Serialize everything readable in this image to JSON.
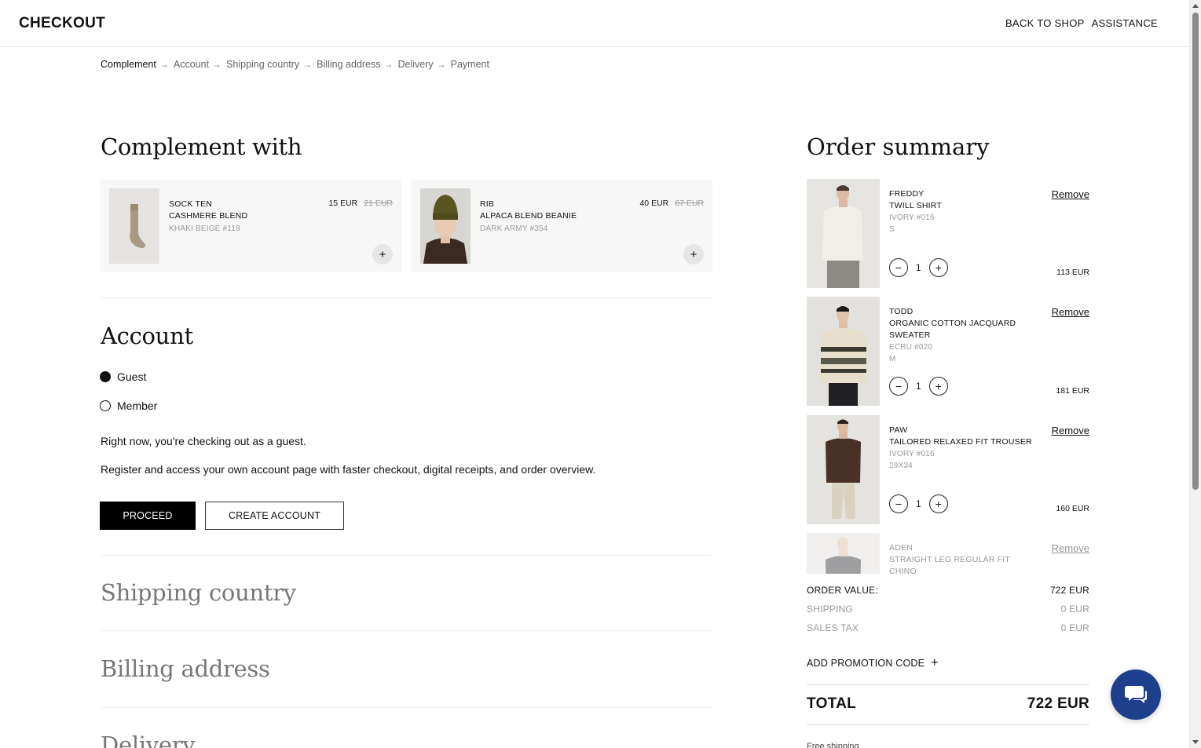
{
  "header": {
    "logo": "CHECKOUT",
    "back_to_shop": "BACK TO SHOP",
    "assistance": "ASSISTANCE"
  },
  "breadcrumb": [
    "Complement",
    "Account",
    "Shipping country",
    "Billing address",
    "Delivery",
    "Payment"
  ],
  "complement": {
    "title": "Complement with",
    "items": [
      {
        "name_line1": "SOCK TEN",
        "name_line2": "CASHMERE BLEND",
        "color": "KHAKI BEIGE #119",
        "price": "15 EUR",
        "old_price": "21 EUR"
      },
      {
        "name_line1": "RIB",
        "name_line2": "ALPACA BLEND BEANIE",
        "color": "DARK ARMY #354",
        "price": "40 EUR",
        "old_price": "67 EUR"
      }
    ]
  },
  "account": {
    "title": "Account",
    "options": [
      "Guest",
      "Member"
    ],
    "selected": "Guest",
    "line1": "Right now, you're checking out as a guest.",
    "line2": "Register and access your own account page with faster checkout, digital receipts, and order overview.",
    "proceed": "PROCEED",
    "create_account": "CREATE ACCOUNT"
  },
  "sections": {
    "shipping": "Shipping country",
    "billing": "Billing address",
    "delivery": "Delivery"
  },
  "summary": {
    "title": "Order summary",
    "remove_label": "Remove",
    "items": [
      {
        "name_line1": "FREDDY",
        "name_line2": "TWILL SHIRT",
        "color": "IVORY #016",
        "size": "S",
        "qty": "1",
        "price": "113 EUR"
      },
      {
        "name_line1": "TODD",
        "name_line2": "ORGANIC COTTON JACQUARD SWEATER",
        "color": "ECRU #020",
        "size": "M",
        "qty": "1",
        "price": "181 EUR"
      },
      {
        "name_line1": "PAW",
        "name_line2": "TAILORED RELAXED FIT TROUSER",
        "color": "IVORY #016",
        "size": "29X34",
        "qty": "1",
        "price": "160 EUR"
      },
      {
        "name_line1": "ADEN",
        "name_line2": "STRAIGHT LEG REGULAR FIT CHINO"
      }
    ],
    "order_value_label": "ORDER VALUE:",
    "order_value": "722 EUR",
    "shipping_label": "SHIPPING",
    "shipping": "0 EUR",
    "tax_label": "SALES TAX",
    "tax": "0 EUR",
    "promo_label": "ADD PROMOTION CODE",
    "total_label": "TOTAL",
    "total": "722 EUR",
    "cut_text": "Free shipping"
  },
  "icons": {
    "arrow": "arrow-right-icon",
    "plus": "plus-icon",
    "minus": "minus-icon",
    "chat": "chat-icon"
  },
  "colors": {
    "primary": "#000000",
    "chat": "#1e3f8c",
    "muted": "#777777"
  }
}
